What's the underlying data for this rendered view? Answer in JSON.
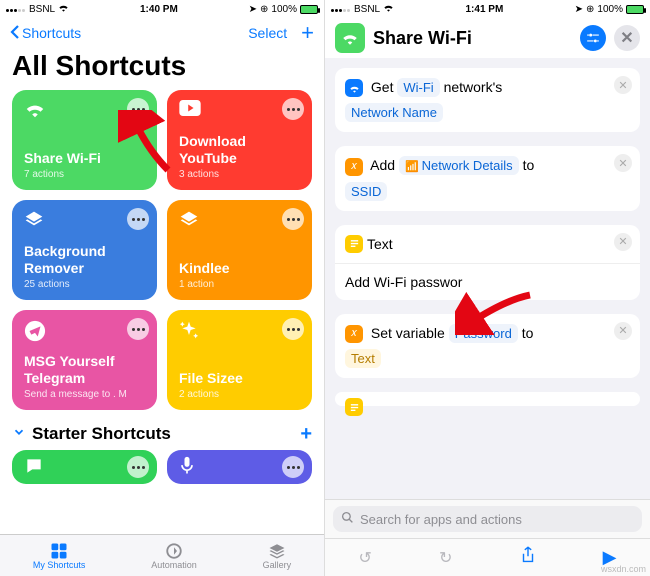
{
  "watermark": "wsxdn.com",
  "left": {
    "status": {
      "carrier": "BSNL",
      "time": "1:40 PM",
      "battery": "100%"
    },
    "nav": {
      "back": "Shortcuts",
      "select": "Select"
    },
    "title": "All Shortcuts",
    "cards": [
      {
        "title": "Share Wi-Fi",
        "sub": "7 actions",
        "color": "#4cd964"
      },
      {
        "title": "Download YouTube",
        "sub": "3 actions",
        "color": "#ff3b30"
      },
      {
        "title": "Background Remover",
        "sub": "25 actions",
        "color": "#3a7dde"
      },
      {
        "title": "Kindlee",
        "sub": "1 action",
        "color": "#ff9500"
      },
      {
        "title": "MSG Yourself Telegram",
        "sub": "Send a message to . M",
        "color": "#e855a4"
      },
      {
        "title": "File Sizee",
        "sub": "2 actions",
        "color": "#ffcc00"
      }
    ],
    "section2": "Starter Shortcuts",
    "starter": [
      {
        "color": "#30d158"
      },
      {
        "color": "#5e5ce6"
      }
    ],
    "tabs": {
      "my": "My Shortcuts",
      "auto": "Automation",
      "gallery": "Gallery"
    }
  },
  "right": {
    "status": {
      "carrier": "BSNL",
      "time": "1:41 PM",
      "battery": "100%"
    },
    "title": "Share Wi-Fi",
    "actions": {
      "a1_pre": "Get",
      "a1_chip": "Wi-Fi",
      "a1_post": "network's",
      "a1_line2": "Network Name",
      "a2_pre": "Add",
      "a2_chip": "Network Details",
      "a2_post": "to",
      "a2_line2": "SSID",
      "a3_title": "Text",
      "a3_body": "Add Wi-Fi passwor",
      "a4_pre": "Set variable",
      "a4_chip": "Password",
      "a4_post": "to",
      "a4_line2": "Text"
    },
    "search_ph": "Search for apps and actions"
  }
}
